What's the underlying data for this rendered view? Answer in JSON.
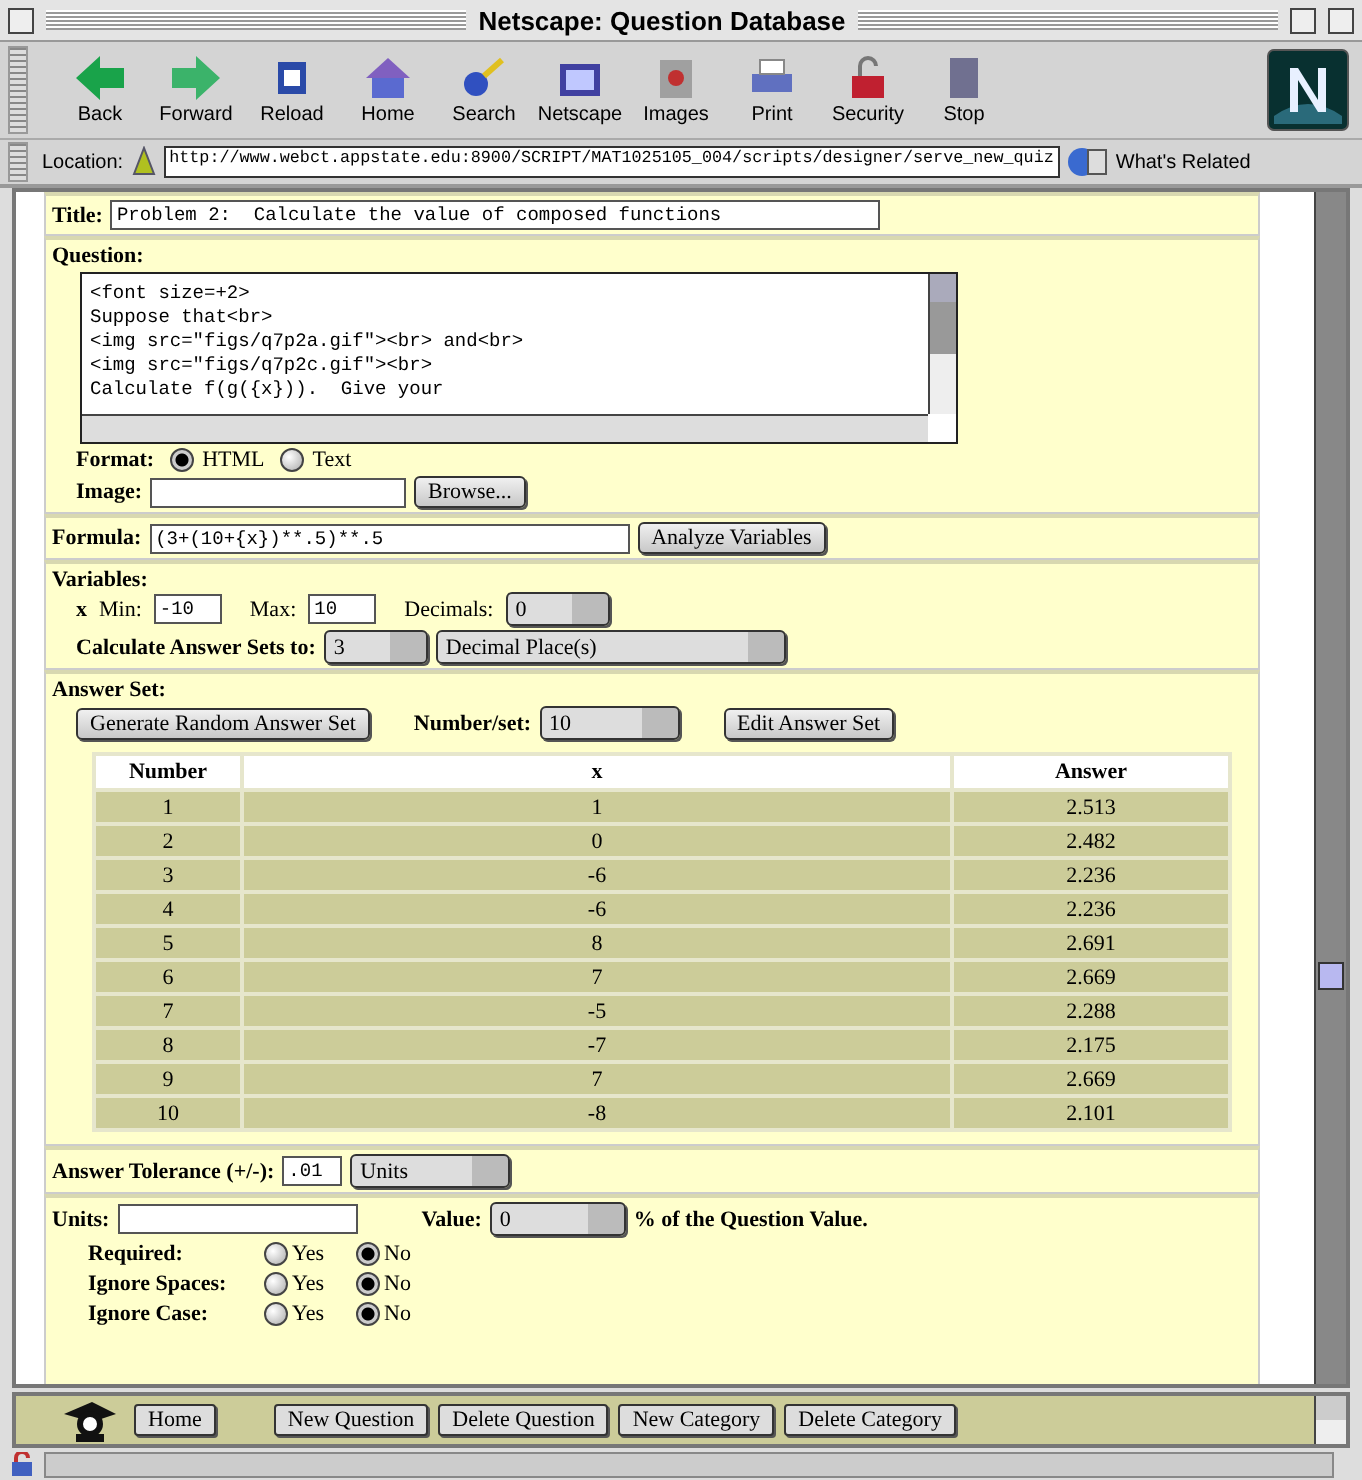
{
  "window": {
    "title": "Netscape: Question Database"
  },
  "toolbar": {
    "buttons": [
      {
        "label": "Back"
      },
      {
        "label": "Forward"
      },
      {
        "label": "Reload"
      },
      {
        "label": "Home"
      },
      {
        "label": "Search"
      },
      {
        "label": "Netscape"
      },
      {
        "label": "Images"
      },
      {
        "label": "Print"
      },
      {
        "label": "Security"
      },
      {
        "label": "Stop"
      }
    ]
  },
  "location": {
    "label": "Location:",
    "url": "http://www.webct.appstate.edu:8900/SCRIPT/MAT1025105_004/scripts/designer/serve_new_quiz",
    "related": "What's Related"
  },
  "form": {
    "title": {
      "label": "Title:",
      "value": "Problem 2:  Calculate the value of composed functions"
    },
    "question": {
      "label": "Question:",
      "lines": [
        "<font size=+2>",
        "Suppose that<br>",
        "<img src=\"figs/q7p2a.gif\"><br> and<br>",
        "<img src=\"figs/q7p2c.gif\"><br>",
        "Calculate f(g({x})).  Give your"
      ]
    },
    "format": {
      "label": "Format:",
      "options": [
        {
          "label": "HTML",
          "selected": true
        },
        {
          "label": "Text",
          "selected": false
        }
      ]
    },
    "image": {
      "label": "Image:",
      "button": "Browse..."
    },
    "formula": {
      "label": "Formula:",
      "value": "(3+(10+{x})**.5)**.5",
      "button": "Analyze Variables"
    },
    "variables": {
      "label": "Variables:",
      "name": "x",
      "min_label": "Min:",
      "min": "-10",
      "max_label": "Max:",
      "max": "10",
      "decimals_label": "Decimals:",
      "decimals": "0",
      "calc_label": "Calculate Answer Sets to:",
      "calc_value": "3",
      "calc_unit": "Decimal Place(s)"
    },
    "answer_set": {
      "label": "Answer Set:",
      "generate_button": "Generate Random Answer Set",
      "number_label": "Number/set:",
      "number_value": "10",
      "edit_button": "Edit Answer Set",
      "columns": [
        "Number",
        "x",
        "Answer"
      ],
      "rows": [
        [
          "1",
          "1",
          "2.513"
        ],
        [
          "2",
          "0",
          "2.482"
        ],
        [
          "3",
          "-6",
          "2.236"
        ],
        [
          "4",
          "-6",
          "2.236"
        ],
        [
          "5",
          "8",
          "2.691"
        ],
        [
          "6",
          "7",
          "2.669"
        ],
        [
          "7",
          "-5",
          "2.288"
        ],
        [
          "8",
          "-7",
          "2.175"
        ],
        [
          "9",
          "7",
          "2.669"
        ],
        [
          "10",
          "-8",
          "2.101"
        ]
      ]
    },
    "tolerance": {
      "label": "Answer Tolerance (+/-):",
      "value": ".01",
      "unit": "Units"
    },
    "units": {
      "label": "Units:",
      "value_label": "Value:",
      "value": "0",
      "suffix": "% of the Question Value.",
      "options": [
        {
          "label": "Required:",
          "choices": [
            {
              "label": "Yes",
              "selected": false
            },
            {
              "label": "No",
              "selected": true
            }
          ]
        },
        {
          "label": "Ignore Spaces:",
          "choices": [
            {
              "label": "Yes",
              "selected": false
            },
            {
              "label": "No",
              "selected": true
            }
          ]
        },
        {
          "label": "Ignore Case:",
          "choices": [
            {
              "label": "Yes",
              "selected": false
            },
            {
              "label": "No",
              "selected": true
            }
          ]
        }
      ]
    }
  },
  "bottom_nav": {
    "buttons": [
      "Home",
      "New Question",
      "Delete Question",
      "New Category",
      "Delete Category"
    ]
  }
}
